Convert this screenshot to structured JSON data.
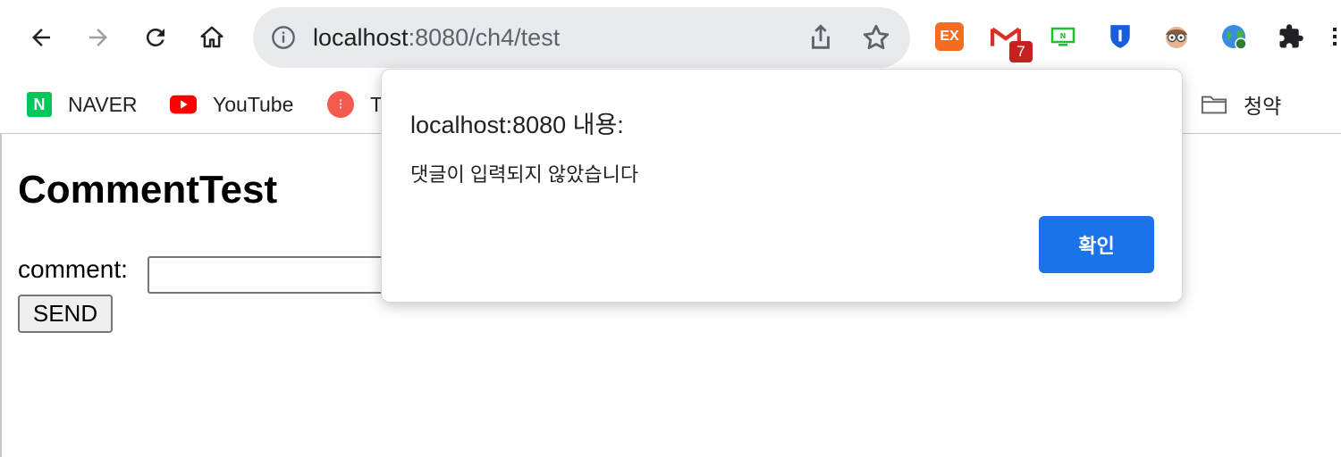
{
  "browser": {
    "url_host": "localhost",
    "url_path": ":8080/ch4/test",
    "extensions": {
      "ex_label": "EX",
      "mail_badge": "7"
    }
  },
  "bookmarks": [
    {
      "label": "NAVER",
      "icon": "naver-icon"
    },
    {
      "label": "YouTube",
      "icon": "youtube-icon"
    },
    {
      "label": "T",
      "icon": "t-icon"
    },
    {
      "label": "청약",
      "icon": "folder-icon"
    }
  ],
  "page": {
    "title": "CommentTest",
    "comment_label": "comment:",
    "comment_value": "",
    "send_label": "SEND"
  },
  "dialog": {
    "title": "localhost:8080 내용:",
    "message": "댓글이 입력되지 않았습니다",
    "ok_label": "확인"
  },
  "colors": {
    "accent": "#1a73e8",
    "naver": "#03c75a",
    "youtube": "#ff0000",
    "ex_extension": "#f26d21"
  }
}
